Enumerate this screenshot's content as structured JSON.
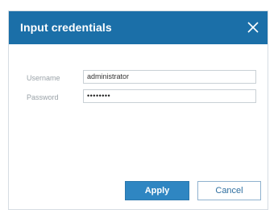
{
  "dialog": {
    "title": "Input credentials",
    "fields": {
      "username_label": "Username",
      "username_value": "administrator",
      "password_label": "Password",
      "password_value": "••••••••"
    },
    "buttons": {
      "apply_label": "Apply",
      "cancel_label": "Cancel"
    },
    "colors": {
      "titlebar": "#1b6fa8",
      "primary_button": "#2f86c2",
      "cancel_text": "#2f6fa0"
    },
    "icons": {
      "close": "close-icon"
    }
  }
}
